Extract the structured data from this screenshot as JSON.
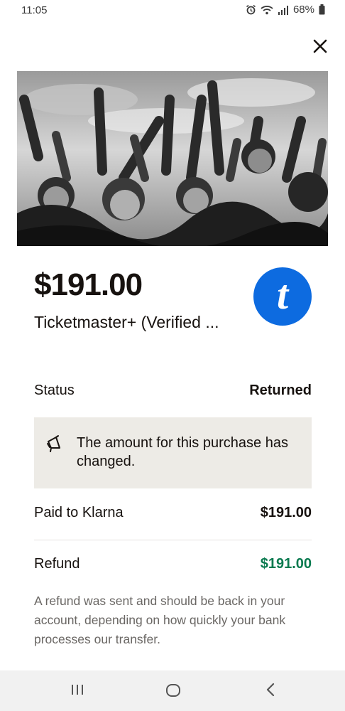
{
  "status_bar": {
    "time": "11:05",
    "battery": "68%",
    "icons": [
      "alarm-icon",
      "wifi-icon",
      "signal-icon",
      "battery-icon"
    ]
  },
  "header": {
    "close_icon": "close-icon"
  },
  "hero": {
    "image": "concert crowd photo"
  },
  "purchase": {
    "amount": "$191.00",
    "merchant": "Ticketmaster+ (Verified ...",
    "merchant_logo_letter": "t",
    "merchant_logo_color": "#0d6be0"
  },
  "status_row": {
    "label": "Status",
    "value": "Returned"
  },
  "notice": {
    "icon": "megaphone-icon",
    "text": "The amount for this purchase has changed."
  },
  "paid_row": {
    "label": "Paid to Klarna",
    "value": "$191.00"
  },
  "refund_row": {
    "label": "Refund",
    "value": "$191.00",
    "value_color": "#0a7a4f"
  },
  "refund_note": "A refund was sent and should be back in your account, depending on how quickly your bank processes our transfer.",
  "nav_bar": {
    "buttons": [
      "recent-apps-icon",
      "home-icon",
      "back-icon"
    ]
  }
}
